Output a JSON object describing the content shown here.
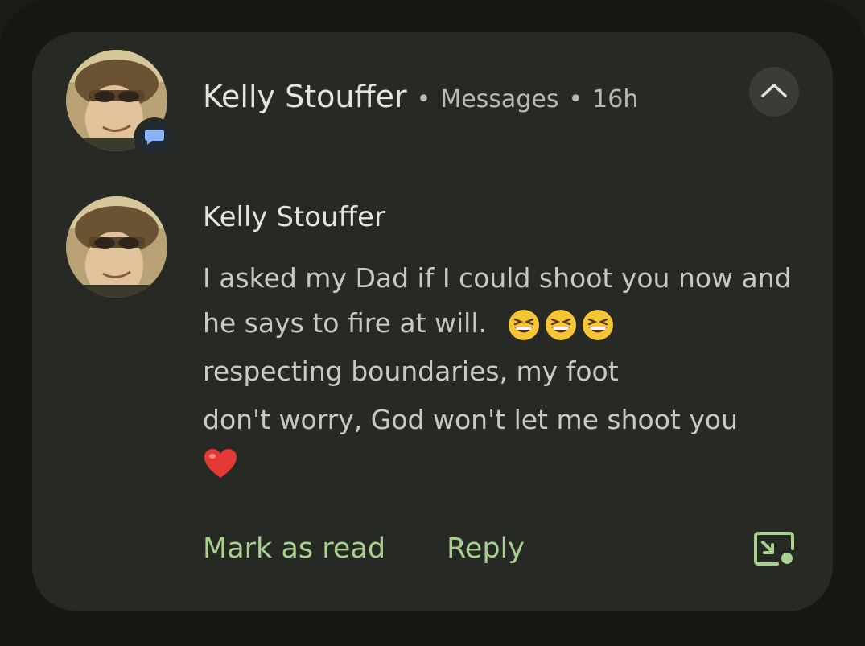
{
  "notification": {
    "sender": "Kelly Stouffer",
    "app_name": "Messages",
    "time": "16h",
    "separator": "•",
    "app_badge_icon": "chat-bubble-icon",
    "collapse_icon": "chevron-up-icon"
  },
  "message": {
    "sender": "Kelly Stouffer",
    "lines": [
      "I asked my Dad if I could shoot you now and he says to fire at will.",
      "respecting boundaries, my foot",
      "don't worry, God won't let me shoot you"
    ],
    "emoji_after_line_1": [
      "grinning-squinting-face-emoji",
      "grinning-squinting-face-emoji",
      "grinning-squinting-face-emoji"
    ],
    "final_emoji": "red-heart-emoji"
  },
  "actions": {
    "mark_as_read": "Mark as read",
    "reply": "Reply",
    "expand_icon": "picture-in-picture-icon"
  },
  "colors": {
    "card_background": "#272925",
    "accent_green": "#a8d18d",
    "badge_blue": "#8ab4f8"
  }
}
